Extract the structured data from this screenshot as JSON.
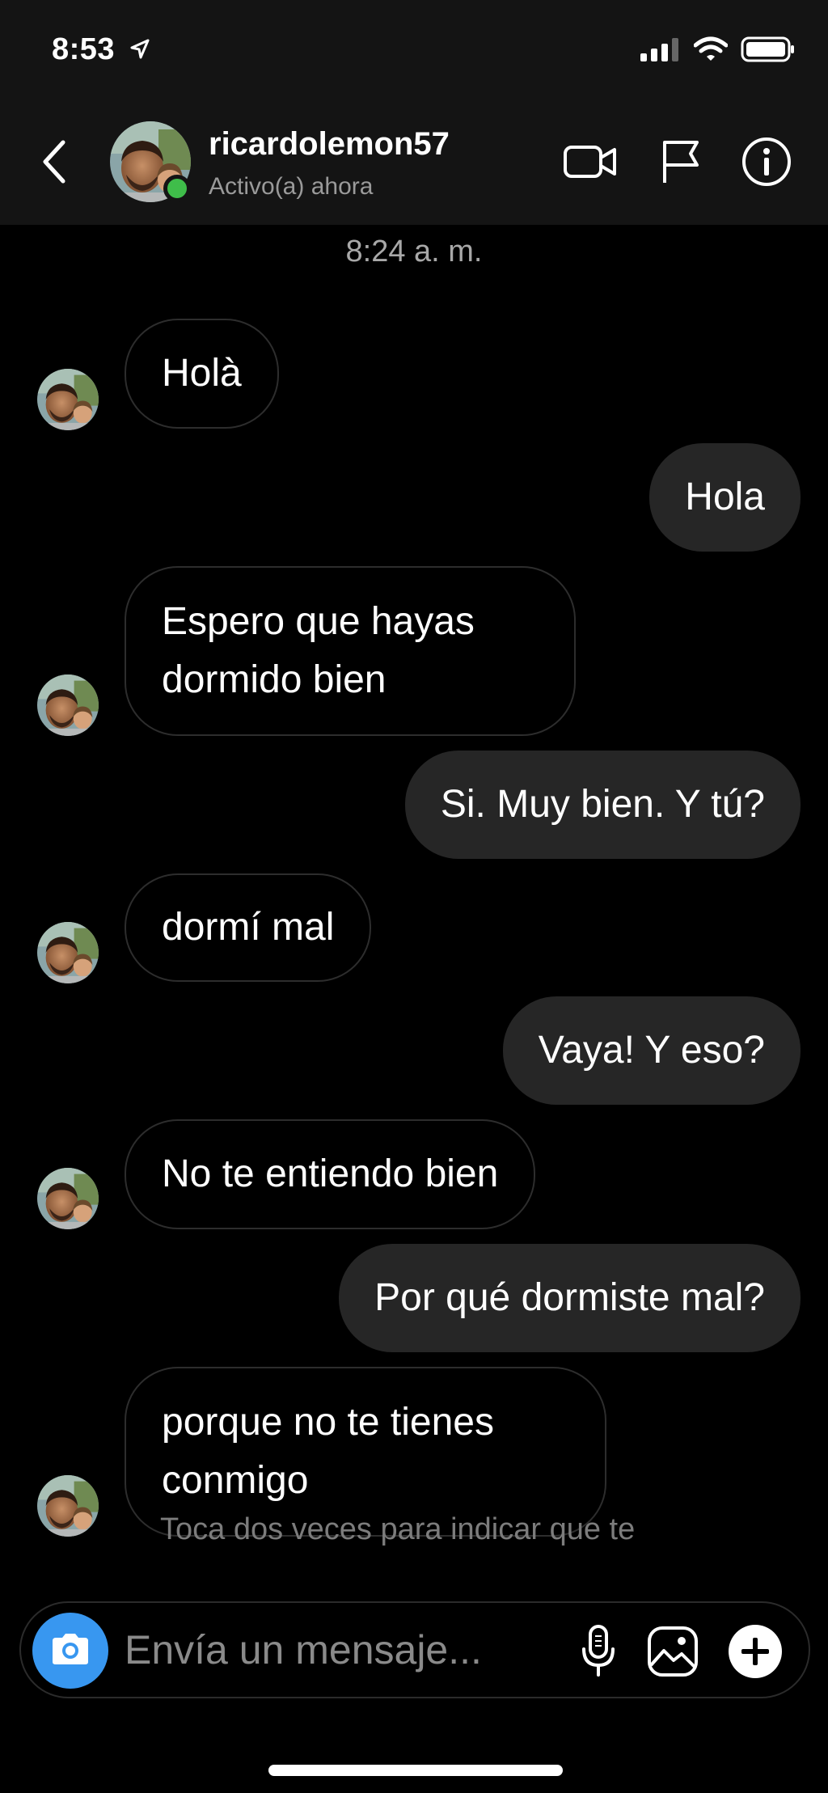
{
  "status_bar": {
    "time": "8:53"
  },
  "header": {
    "username": "ricardolemon57",
    "activity": "Activo(a) ahora"
  },
  "thread": {
    "timestamp": "8:24 a. m.",
    "messages": [
      {
        "from": "them",
        "text": "Holà"
      },
      {
        "from": "me",
        "text": "Hola"
      },
      {
        "from": "them",
        "lines": [
          "Espero que hayas",
          "dormido bien"
        ]
      },
      {
        "from": "me",
        "text": "Si. Muy bien. Y tú?"
      },
      {
        "from": "them",
        "text": "dormí mal"
      },
      {
        "from": "me",
        "text": "Vaya! Y eso?"
      },
      {
        "from": "them",
        "text": "No te entiendo bien"
      },
      {
        "from": "me",
        "text": "Por qué dormiste mal?"
      },
      {
        "from": "them",
        "lines": [
          "porque no te tienes",
          "conmigo"
        ]
      }
    ],
    "like_hint": "Toca dos veces para indicar que te"
  },
  "composer": {
    "placeholder": "Envía un mensaje..."
  },
  "colors": {
    "accent": "#3897f0",
    "online": "#3fbd4a",
    "sent_bubble": "#262626"
  },
  "icons": [
    "back-chevron-icon",
    "video-call-icon",
    "flag-icon",
    "info-icon",
    "camera-icon",
    "microphone-icon",
    "gallery-icon",
    "plus-icon"
  ]
}
